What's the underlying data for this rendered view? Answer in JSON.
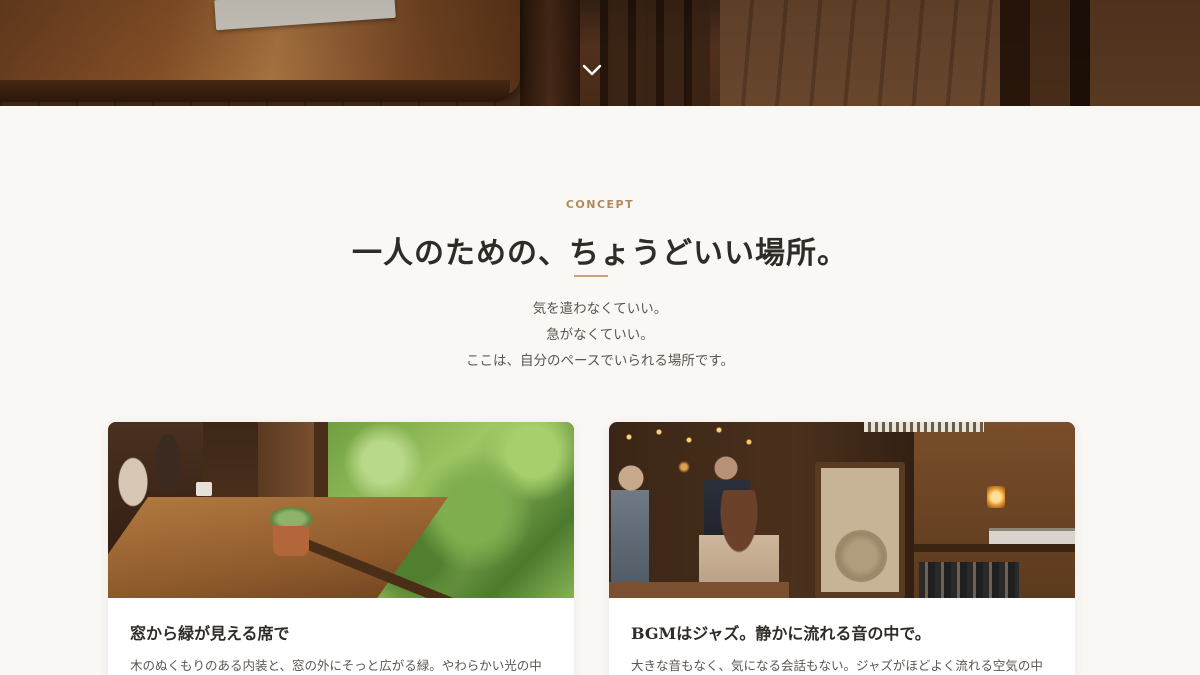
{
  "hero": {
    "scroll_icon": "chevron-down-icon"
  },
  "concept": {
    "label": "CONCEPT",
    "title": "一人のための、ちょうどいい場所。",
    "lines": [
      "気を遣わなくていい。",
      "急がなくていい。",
      "ここは、自分のペースでいられる場所です。"
    ]
  },
  "cards": [
    {
      "title": "窓から緑が見える席で",
      "text": "木のぬくもりのある内装と、窓の外にそっと広がる緑。やわらかい光の中"
    },
    {
      "title": "BGMはジャズ。静かに流れる音の中で。",
      "text": "大きな音もなく、気になる会話もない。ジャズがほどよく流れる空気の中"
    }
  ],
  "colors": {
    "background": "#faf8f5",
    "accent": "#c9a37a",
    "label": "#b18b5f",
    "heading": "#2f2b27"
  }
}
